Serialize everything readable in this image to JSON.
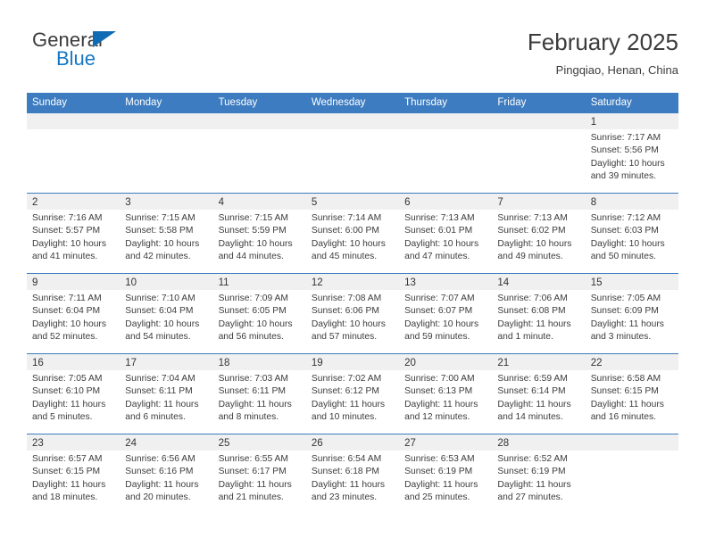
{
  "logo": {
    "primary_text": "General",
    "secondary_text": "Blue",
    "triangle_icon": "triangle-icon",
    "brand_blue": "#1477c4"
  },
  "header": {
    "title": "February 2025",
    "subtitle": "Pingqiao, Henan, China"
  },
  "colors": {
    "header_blue": "#3d7cc0",
    "day_band_gray": "#f0f0f0",
    "text": "#3c3c3c"
  },
  "weekdays": [
    "Sunday",
    "Monday",
    "Tuesday",
    "Wednesday",
    "Thursday",
    "Friday",
    "Saturday"
  ],
  "weeks": [
    [
      {
        "day": "",
        "empty": true
      },
      {
        "day": "",
        "empty": true
      },
      {
        "day": "",
        "empty": true
      },
      {
        "day": "",
        "empty": true
      },
      {
        "day": "",
        "empty": true
      },
      {
        "day": "",
        "empty": true
      },
      {
        "day": "1",
        "sunrise": "Sunrise: 7:17 AM",
        "sunset": "Sunset: 5:56 PM",
        "daylight_1": "Daylight: 10 hours",
        "daylight_2": "and 39 minutes."
      }
    ],
    [
      {
        "day": "2",
        "sunrise": "Sunrise: 7:16 AM",
        "sunset": "Sunset: 5:57 PM",
        "daylight_1": "Daylight: 10 hours",
        "daylight_2": "and 41 minutes."
      },
      {
        "day": "3",
        "sunrise": "Sunrise: 7:15 AM",
        "sunset": "Sunset: 5:58 PM",
        "daylight_1": "Daylight: 10 hours",
        "daylight_2": "and 42 minutes."
      },
      {
        "day": "4",
        "sunrise": "Sunrise: 7:15 AM",
        "sunset": "Sunset: 5:59 PM",
        "daylight_1": "Daylight: 10 hours",
        "daylight_2": "and 44 minutes."
      },
      {
        "day": "5",
        "sunrise": "Sunrise: 7:14 AM",
        "sunset": "Sunset: 6:00 PM",
        "daylight_1": "Daylight: 10 hours",
        "daylight_2": "and 45 minutes."
      },
      {
        "day": "6",
        "sunrise": "Sunrise: 7:13 AM",
        "sunset": "Sunset: 6:01 PM",
        "daylight_1": "Daylight: 10 hours",
        "daylight_2": "and 47 minutes."
      },
      {
        "day": "7",
        "sunrise": "Sunrise: 7:13 AM",
        "sunset": "Sunset: 6:02 PM",
        "daylight_1": "Daylight: 10 hours",
        "daylight_2": "and 49 minutes."
      },
      {
        "day": "8",
        "sunrise": "Sunrise: 7:12 AM",
        "sunset": "Sunset: 6:03 PM",
        "daylight_1": "Daylight: 10 hours",
        "daylight_2": "and 50 minutes."
      }
    ],
    [
      {
        "day": "9",
        "sunrise": "Sunrise: 7:11 AM",
        "sunset": "Sunset: 6:04 PM",
        "daylight_1": "Daylight: 10 hours",
        "daylight_2": "and 52 minutes."
      },
      {
        "day": "10",
        "sunrise": "Sunrise: 7:10 AM",
        "sunset": "Sunset: 6:04 PM",
        "daylight_1": "Daylight: 10 hours",
        "daylight_2": "and 54 minutes."
      },
      {
        "day": "11",
        "sunrise": "Sunrise: 7:09 AM",
        "sunset": "Sunset: 6:05 PM",
        "daylight_1": "Daylight: 10 hours",
        "daylight_2": "and 56 minutes."
      },
      {
        "day": "12",
        "sunrise": "Sunrise: 7:08 AM",
        "sunset": "Sunset: 6:06 PM",
        "daylight_1": "Daylight: 10 hours",
        "daylight_2": "and 57 minutes."
      },
      {
        "day": "13",
        "sunrise": "Sunrise: 7:07 AM",
        "sunset": "Sunset: 6:07 PM",
        "daylight_1": "Daylight: 10 hours",
        "daylight_2": "and 59 minutes."
      },
      {
        "day": "14",
        "sunrise": "Sunrise: 7:06 AM",
        "sunset": "Sunset: 6:08 PM",
        "daylight_1": "Daylight: 11 hours",
        "daylight_2": "and 1 minute."
      },
      {
        "day": "15",
        "sunrise": "Sunrise: 7:05 AM",
        "sunset": "Sunset: 6:09 PM",
        "daylight_1": "Daylight: 11 hours",
        "daylight_2": "and 3 minutes."
      }
    ],
    [
      {
        "day": "16",
        "sunrise": "Sunrise: 7:05 AM",
        "sunset": "Sunset: 6:10 PM",
        "daylight_1": "Daylight: 11 hours",
        "daylight_2": "and 5 minutes."
      },
      {
        "day": "17",
        "sunrise": "Sunrise: 7:04 AM",
        "sunset": "Sunset: 6:11 PM",
        "daylight_1": "Daylight: 11 hours",
        "daylight_2": "and 6 minutes."
      },
      {
        "day": "18",
        "sunrise": "Sunrise: 7:03 AM",
        "sunset": "Sunset: 6:11 PM",
        "daylight_1": "Daylight: 11 hours",
        "daylight_2": "and 8 minutes."
      },
      {
        "day": "19",
        "sunrise": "Sunrise: 7:02 AM",
        "sunset": "Sunset: 6:12 PM",
        "daylight_1": "Daylight: 11 hours",
        "daylight_2": "and 10 minutes."
      },
      {
        "day": "20",
        "sunrise": "Sunrise: 7:00 AM",
        "sunset": "Sunset: 6:13 PM",
        "daylight_1": "Daylight: 11 hours",
        "daylight_2": "and 12 minutes."
      },
      {
        "day": "21",
        "sunrise": "Sunrise: 6:59 AM",
        "sunset": "Sunset: 6:14 PM",
        "daylight_1": "Daylight: 11 hours",
        "daylight_2": "and 14 minutes."
      },
      {
        "day": "22",
        "sunrise": "Sunrise: 6:58 AM",
        "sunset": "Sunset: 6:15 PM",
        "daylight_1": "Daylight: 11 hours",
        "daylight_2": "and 16 minutes."
      }
    ],
    [
      {
        "day": "23",
        "sunrise": "Sunrise: 6:57 AM",
        "sunset": "Sunset: 6:15 PM",
        "daylight_1": "Daylight: 11 hours",
        "daylight_2": "and 18 minutes."
      },
      {
        "day": "24",
        "sunrise": "Sunrise: 6:56 AM",
        "sunset": "Sunset: 6:16 PM",
        "daylight_1": "Daylight: 11 hours",
        "daylight_2": "and 20 minutes."
      },
      {
        "day": "25",
        "sunrise": "Sunrise: 6:55 AM",
        "sunset": "Sunset: 6:17 PM",
        "daylight_1": "Daylight: 11 hours",
        "daylight_2": "and 21 minutes."
      },
      {
        "day": "26",
        "sunrise": "Sunrise: 6:54 AM",
        "sunset": "Sunset: 6:18 PM",
        "daylight_1": "Daylight: 11 hours",
        "daylight_2": "and 23 minutes."
      },
      {
        "day": "27",
        "sunrise": "Sunrise: 6:53 AM",
        "sunset": "Sunset: 6:19 PM",
        "daylight_1": "Daylight: 11 hours",
        "daylight_2": "and 25 minutes."
      },
      {
        "day": "28",
        "sunrise": "Sunrise: 6:52 AM",
        "sunset": "Sunset: 6:19 PM",
        "daylight_1": "Daylight: 11 hours",
        "daylight_2": "and 27 minutes."
      },
      {
        "day": "",
        "empty": true
      }
    ]
  ]
}
